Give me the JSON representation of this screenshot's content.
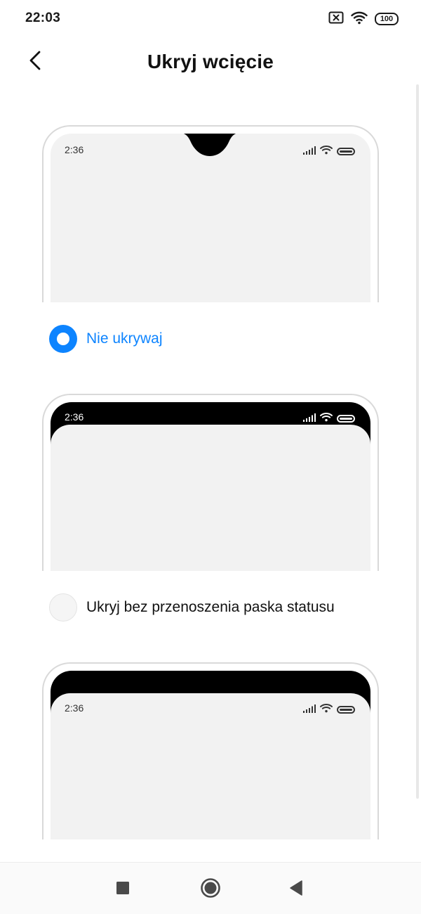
{
  "status_bar": {
    "time": "22:03",
    "battery": "100",
    "icons": [
      "sim-off-icon",
      "wifi-icon",
      "battery-icon"
    ]
  },
  "header": {
    "title": "Ukryj wcięcie",
    "back_icon": "back-arrow-icon"
  },
  "previews": [
    {
      "style": "notch-visible",
      "time": "2:36"
    },
    {
      "style": "hide-notch-keep-status",
      "time": "2:36"
    },
    {
      "style": "hide-notch-move-status",
      "time": "2:36"
    }
  ],
  "options": [
    {
      "label": "Nie ukrywaj",
      "selected": true
    },
    {
      "label": "Ukryj bez przenoszenia paska statusu",
      "selected": false
    }
  ],
  "nav_bar": {
    "icons": [
      "recents-square-icon",
      "home-circle-icon",
      "back-triangle-icon"
    ]
  },
  "colors": {
    "accent": "#0d84ff",
    "preview_screen": "#f2f2f2",
    "frame": "#d9d9d9"
  }
}
